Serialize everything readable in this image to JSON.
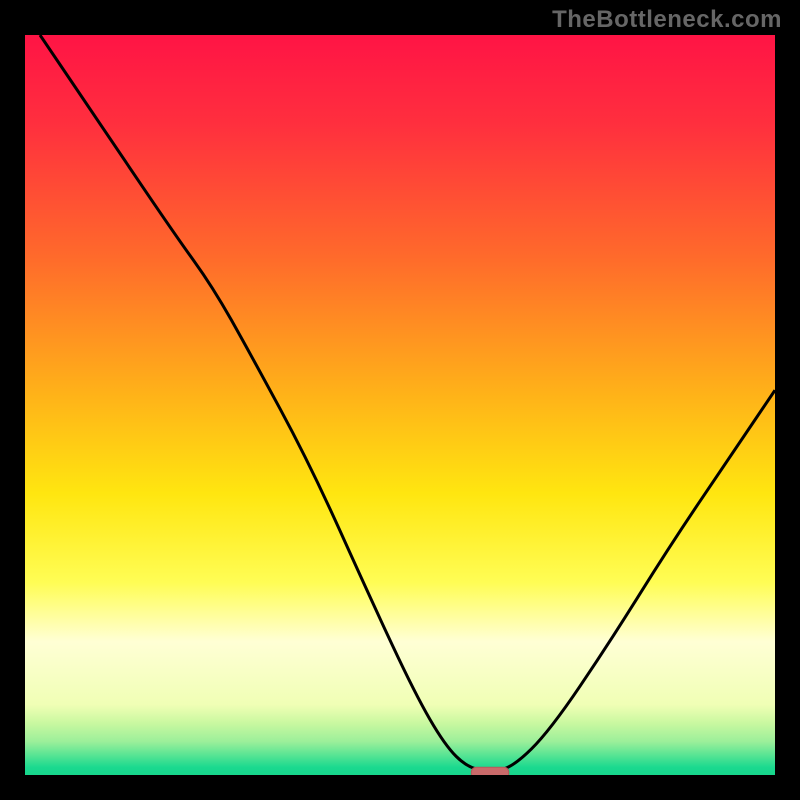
{
  "watermark": "TheBottleneck.com",
  "colors": {
    "frame": "#000000",
    "curve": "#000000",
    "marker_fill": "#c96a6a",
    "marker_stroke": "#b25a5a",
    "gradient_stops": [
      {
        "offset": 0.0,
        "color": "#ff1445"
      },
      {
        "offset": 0.12,
        "color": "#ff2f3e"
      },
      {
        "offset": 0.3,
        "color": "#ff6a2b"
      },
      {
        "offset": 0.48,
        "color": "#ffb019"
      },
      {
        "offset": 0.62,
        "color": "#ffe610"
      },
      {
        "offset": 0.74,
        "color": "#fffd55"
      },
      {
        "offset": 0.82,
        "color": "#ffffd5"
      },
      {
        "offset": 0.905,
        "color": "#f0ffb5"
      },
      {
        "offset": 0.93,
        "color": "#c9f8a0"
      },
      {
        "offset": 0.955,
        "color": "#9bef9a"
      },
      {
        "offset": 0.972,
        "color": "#5ce594"
      },
      {
        "offset": 0.99,
        "color": "#1ad98f"
      },
      {
        "offset": 1.0,
        "color": "#17d68c"
      }
    ]
  },
  "chart_data": {
    "type": "line",
    "title": "",
    "xlabel": "",
    "ylabel": "",
    "xlim": [
      0,
      100
    ],
    "ylim": [
      0,
      100
    ],
    "bottleneck_point_x": 62,
    "curve": [
      {
        "x": 2,
        "y": 100
      },
      {
        "x": 10,
        "y": 88
      },
      {
        "x": 20,
        "y": 73
      },
      {
        "x": 25,
        "y": 66
      },
      {
        "x": 30,
        "y": 57
      },
      {
        "x": 38,
        "y": 42
      },
      {
        "x": 46,
        "y": 24
      },
      {
        "x": 52,
        "y": 11
      },
      {
        "x": 56,
        "y": 4
      },
      {
        "x": 59,
        "y": 1
      },
      {
        "x": 62,
        "y": 0.5
      },
      {
        "x": 65,
        "y": 1
      },
      {
        "x": 70,
        "y": 6
      },
      {
        "x": 78,
        "y": 18
      },
      {
        "x": 86,
        "y": 31
      },
      {
        "x": 94,
        "y": 43
      },
      {
        "x": 100,
        "y": 52
      }
    ],
    "marker": {
      "x": 62,
      "y": 0.3,
      "w": 5,
      "h": 1.5
    }
  }
}
